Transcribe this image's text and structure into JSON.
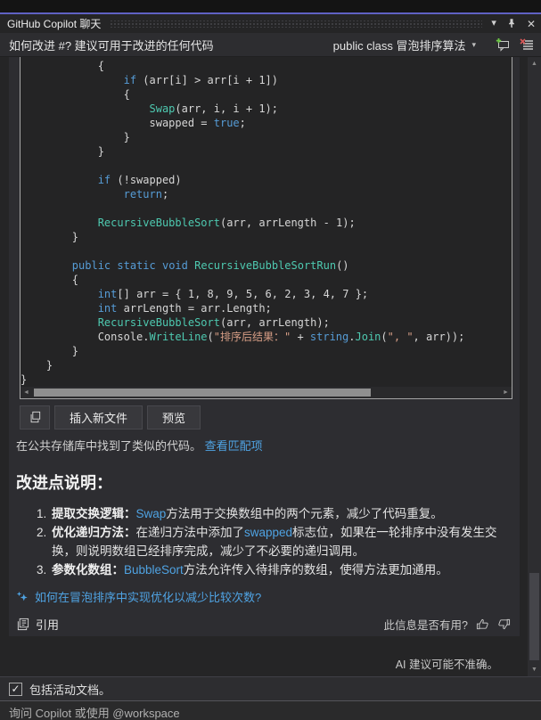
{
  "titlebar": {
    "title": "GitHub Copilot 聊天"
  },
  "toolbar": {
    "question": "如何改进 #? 建议可用于改进的任何代码",
    "context_selector": "public class 冒泡排序算法"
  },
  "code_block": {
    "language": "csharp",
    "lines": [
      [
        [
          "            {",
          "p"
        ]
      ],
      [
        [
          "                ",
          "p"
        ],
        [
          "if",
          "k"
        ],
        [
          " (arr[i] > arr[i + 1])",
          "p"
        ]
      ],
      [
        [
          "                {",
          "p"
        ]
      ],
      [
        [
          "                    ",
          "p"
        ],
        [
          "Swap",
          "t"
        ],
        [
          "(arr, i, i + 1);",
          "p"
        ]
      ],
      [
        [
          "                    swapped = ",
          "p"
        ],
        [
          "true",
          "k"
        ],
        [
          ";",
          "p"
        ]
      ],
      [
        [
          "                }",
          "p"
        ]
      ],
      [
        [
          "            }",
          "p"
        ]
      ],
      [],
      [
        [
          "            ",
          "p"
        ],
        [
          "if",
          "k"
        ],
        [
          " (!swapped)",
          "p"
        ]
      ],
      [
        [
          "                ",
          "p"
        ],
        [
          "return",
          "k"
        ],
        [
          ";",
          "p"
        ]
      ],
      [],
      [
        [
          "            ",
          "p"
        ],
        [
          "RecursiveBubbleSort",
          "t"
        ],
        [
          "(arr, arrLength - 1);",
          "p"
        ]
      ],
      [
        [
          "        }",
          "p"
        ]
      ],
      [],
      [
        [
          "        ",
          "p"
        ],
        [
          "public",
          "k"
        ],
        [
          " ",
          "p"
        ],
        [
          "static",
          "k"
        ],
        [
          " ",
          "p"
        ],
        [
          "void",
          "k"
        ],
        [
          " ",
          "p"
        ],
        [
          "RecursiveBubbleSortRun",
          "t"
        ],
        [
          "()",
          "p"
        ]
      ],
      [
        [
          "        {",
          "p"
        ]
      ],
      [
        [
          "            ",
          "p"
        ],
        [
          "int",
          "k"
        ],
        [
          "[] arr = { 1, 8, 9, 5, 6, 2, 3, 4, 7 };",
          "p"
        ]
      ],
      [
        [
          "            ",
          "p"
        ],
        [
          "int",
          "k"
        ],
        [
          " arrLength = arr.Length;",
          "p"
        ]
      ],
      [
        [
          "            ",
          "p"
        ],
        [
          "RecursiveBubbleSort",
          "t"
        ],
        [
          "(arr, arrLength);",
          "p"
        ]
      ],
      [
        [
          "            Console.",
          "p"
        ],
        [
          "WriteLine",
          "t"
        ],
        [
          "(",
          "p"
        ],
        [
          "\"排序后结果：\"",
          "s"
        ],
        [
          " + ",
          "p"
        ],
        [
          "string",
          "k"
        ],
        [
          ".",
          "p"
        ],
        [
          "Join",
          "t"
        ],
        [
          "(",
          "p"
        ],
        [
          "\", \"",
          "s"
        ],
        [
          ", arr));",
          "p"
        ]
      ],
      [
        [
          "        }",
          "p"
        ]
      ],
      [
        [
          "    }",
          "p"
        ]
      ],
      [
        [
          "}",
          "p"
        ]
      ]
    ]
  },
  "code_actions": {
    "insert_label": "插入新文件",
    "preview_label": "预览"
  },
  "similar_code": {
    "text": "在公共存储库中找到了类似的代码。",
    "link_label": "查看匹配项"
  },
  "explanation": {
    "heading": "改进点说明：",
    "items": [
      {
        "parts": [
          [
            "提取交换逻辑：",
            "b"
          ],
          [
            "Swap",
            "c"
          ],
          [
            "方法用于交换数组中的两个元素，减少了代码重复。",
            "p"
          ]
        ]
      },
      {
        "parts": [
          [
            "优化递归方法：",
            "b"
          ],
          [
            "在递归方法中添加了",
            "p"
          ],
          [
            "swapped",
            "c"
          ],
          [
            "标志位，如果在一轮排序中没有发生交换，则说明数组已经排序完成，减少了不必要的递归调用。",
            "p"
          ]
        ]
      },
      {
        "parts": [
          [
            "参数化数组：",
            "b"
          ],
          [
            "BubbleSort",
            "c"
          ],
          [
            "方法允许传入待排序的数组，使得方法更加通用。",
            "p"
          ]
        ]
      }
    ]
  },
  "followup": {
    "label": "如何在冒泡排序中实现优化以减少比较次数?"
  },
  "message_footer": {
    "references_label": "引用",
    "helpful_label": "此信息是否有用?"
  },
  "disclaimer": "AI 建议可能不准确。",
  "footer": {
    "checkbox_label": "包括活动文档。",
    "checkbox_checked": true,
    "checkbox_glyph": "✓",
    "input_placeholder": "询问 Copilot 或使用 @workspace"
  },
  "icons": {
    "chevron_down": "▾",
    "close": "✕",
    "arrow_up": "▲",
    "arrow_down": "▼",
    "arrow_left": "◄",
    "arrow_right": "►"
  },
  "colors": {
    "accent": "#5f61c3",
    "link": "#4fa3e3",
    "keyword": "#569cd6",
    "type": "#4ec9b0",
    "string": "#d69d85",
    "plus_green": "#6cc644",
    "clear_red": "#d95858"
  }
}
